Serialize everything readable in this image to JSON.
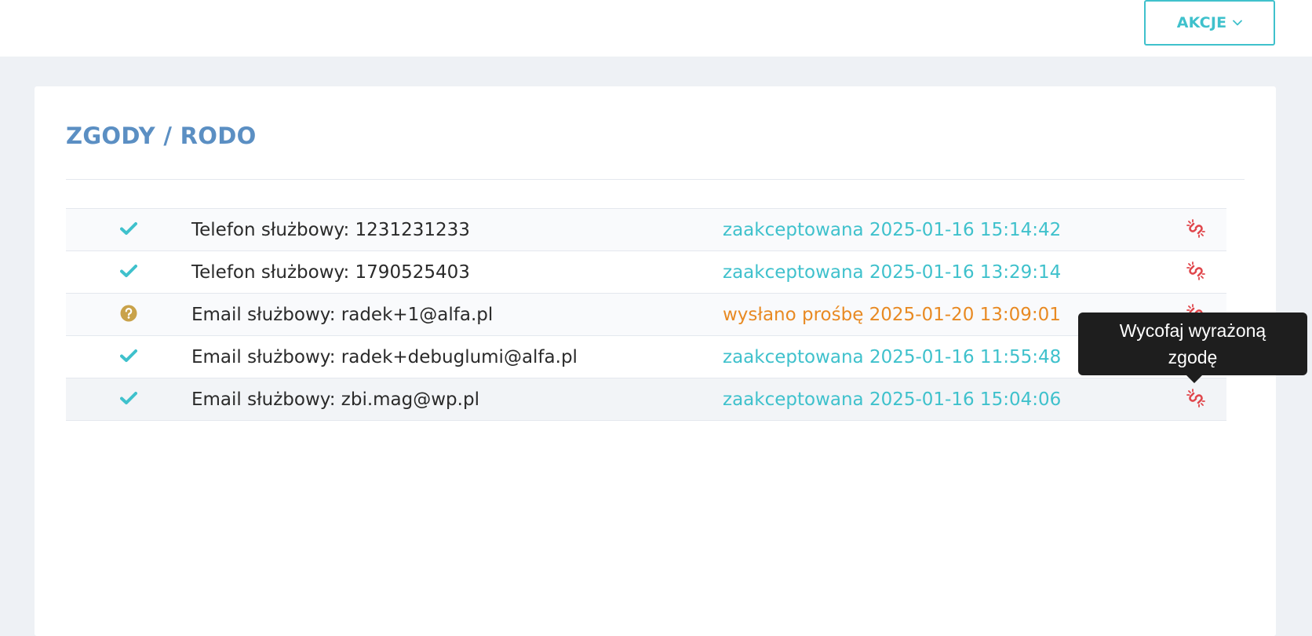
{
  "header": {
    "actions_label": "AKCJE",
    "actions_icon": "chevron-down-icon"
  },
  "section": {
    "title": "ZGODY / RODO"
  },
  "consents": [
    {
      "status_icon": "check-icon",
      "label": "Telefon służbowy: 1231231233",
      "status": "zaakceptowana 2025-01-16 15:14:42",
      "status_type": "accepted",
      "action_icon": "unlink-icon"
    },
    {
      "status_icon": "check-icon",
      "label": "Telefon służbowy: 1790525403",
      "status": "zaakceptowana 2025-01-16 13:29:14",
      "status_type": "accepted",
      "action_icon": "unlink-icon"
    },
    {
      "status_icon": "question-circle-icon",
      "label": "Email służbowy: radek+1@alfa.pl",
      "status": "wysłano prośbę 2025-01-20 13:09:01",
      "status_type": "pending",
      "action_icon": "unlink-icon"
    },
    {
      "status_icon": "check-icon",
      "label": "Email służbowy: radek+debuglumi@alfa.pl",
      "status": "zaakceptowana 2025-01-16 11:55:48",
      "status_type": "accepted",
      "action_icon": "unlink-icon"
    },
    {
      "status_icon": "check-icon",
      "label": "Email służbowy: zbi.mag@wp.pl",
      "status": "zaakceptowana 2025-01-16 15:04:06",
      "status_type": "accepted",
      "action_icon": "unlink-icon"
    }
  ],
  "tooltip": {
    "line1": "Wycofaj wyrażoną",
    "line2": "zgodę"
  },
  "colors": {
    "accent": "#3fc1cc",
    "title": "#5b8fc3",
    "pending": "#e88a23",
    "question_icon": "#c9a24a",
    "danger": "#e0474c"
  }
}
